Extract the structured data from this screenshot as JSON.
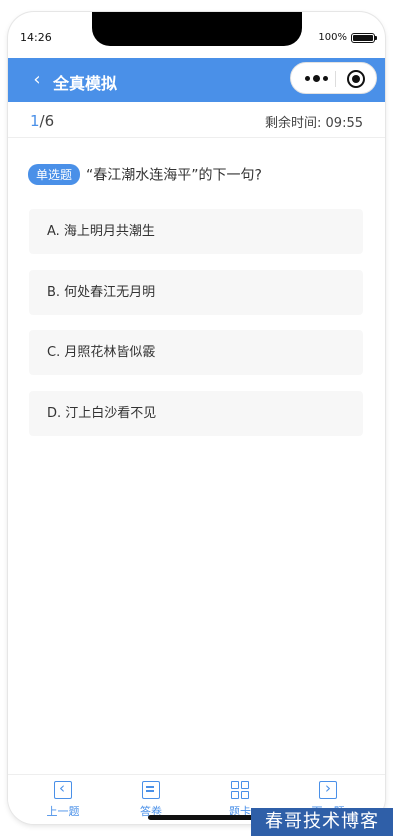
{
  "status_bar": {
    "time": "14:26",
    "battery": "100%"
  },
  "navbar": {
    "back_icon": "chevron-left-icon",
    "title": "全真模拟"
  },
  "capsule": {
    "more_icon": "more-dots-icon",
    "close_icon": "target-circle-icon"
  },
  "progress": {
    "current": "1",
    "total": "/6",
    "timer_label": "剩余时间:",
    "timer_value": "09:55"
  },
  "question": {
    "type_tag": "单选题",
    "text": "“春江潮水连海平”的下一句?",
    "options": [
      "A. 海上明月共潮生",
      "B. 何处春江无月明",
      "C. 月照花林皆似霰",
      "D. 汀上白沙看不见"
    ]
  },
  "tabbar": {
    "items": [
      {
        "label": "上一题",
        "icon": "prev-square-icon"
      },
      {
        "label": "答卷",
        "icon": "answer-sheet-icon"
      },
      {
        "label": "题卡",
        "icon": "grid-icon"
      },
      {
        "label": "下一题",
        "icon": "next-square-icon"
      }
    ]
  },
  "watermark": "春哥技术博客",
  "colors": {
    "primary": "#4a90e8",
    "option_bg": "#f7f7f7"
  }
}
